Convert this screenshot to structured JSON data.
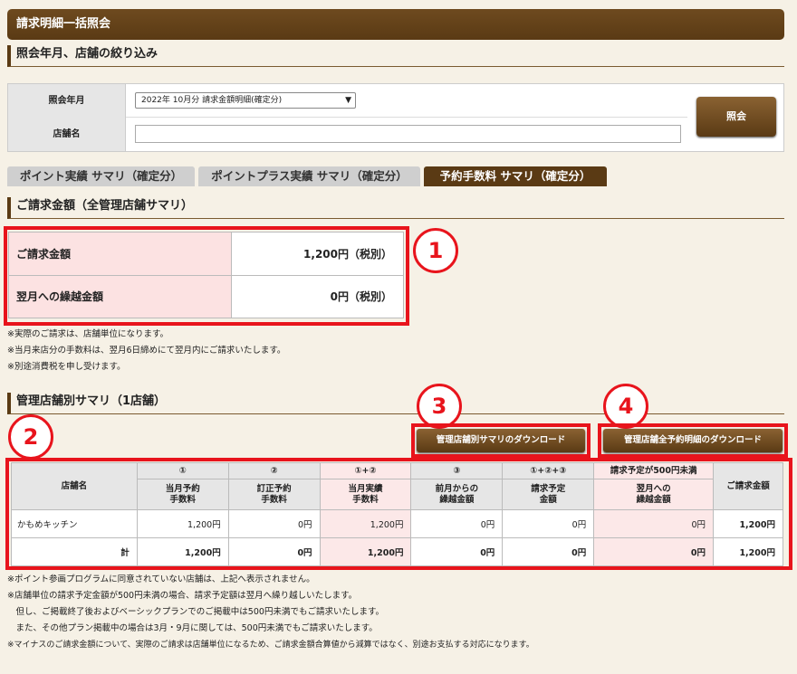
{
  "title": "請求明細一括照会",
  "section_filter": "照会年月、店舗の絞り込み",
  "filter": {
    "month_label": "照会年月",
    "month_value": "2022年 10月分 請求金額明細(確定分)",
    "store_label": "店舗名",
    "store_value": "",
    "query_button": "照会"
  },
  "tabs": [
    "ポイント実績 サマリ（確定分）",
    "ポイントプラス実績 サマリ（確定分）",
    "予約手数料 サマリ（確定分）"
  ],
  "section_billing": "ご請求金額（全管理店舗サマリ）",
  "billing": {
    "rows": [
      {
        "label": "ご請求金額",
        "value": "1,200円（税別）"
      },
      {
        "label": "翌月への繰越金額",
        "value": "0円（税別）"
      }
    ]
  },
  "notes_top": [
    "※実際のご請求は、店舗単位になります。",
    "※当月来店分の手数料は、翌月6日締めにて翌月内にご請求いたします。",
    "※別途消費税を申し受けます。"
  ],
  "section_stores": "管理店舗別サマリ（1店舗）",
  "callouts": [
    "1",
    "2",
    "3",
    "4"
  ],
  "downloads": {
    "store_summary": "管理店舗別サマリのダウンロード",
    "all_details": "管理店舗全予約明細のダウンロード"
  },
  "table": {
    "store_header": "店舗名",
    "total_header": "ご請求金額",
    "pending_group": "請求予定が500円未満",
    "marks": [
      "①",
      "②",
      "①+②",
      "③",
      "①+②+③"
    ],
    "columns": [
      [
        "当月予約",
        "手数料"
      ],
      [
        "訂正予約",
        "手数料"
      ],
      [
        "当月実績",
        "手数料"
      ],
      [
        "前月からの",
        "繰越金額"
      ],
      [
        "請求予定",
        "金額"
      ],
      [
        "翌月への",
        "繰越金額"
      ]
    ],
    "rows": [
      {
        "name": "かもめキッチン",
        "values": [
          "1,200円",
          "0円",
          "1,200円",
          "0円",
          "0円",
          "0円",
          "1,200円"
        ]
      },
      {
        "name": "計",
        "values": [
          "1,200円",
          "0円",
          "1,200円",
          "0円",
          "0円",
          "0円",
          "1,200円"
        ]
      }
    ]
  },
  "notes_bottom": [
    "※ポイント参画プログラムに同意されていない店舗は、上記へ表示されません。",
    "※店舗単位の請求予定金額が500円未満の場合、請求予定額は翌月へ繰り越しいたします。",
    "　但し、ご掲載終了後およびベーシックプランでのご掲載中は500円未満でもご請求いたします。",
    "　また、その他プラン掲載中の場合は3月・9月に関しては、500円未満でもご請求いたします。",
    "※マイナスのご請求金額について、実際のご請求は店舗単位になるため、ご請求金額合算値から減算ではなく、別途お支払する対応になります。"
  ],
  "colors": {
    "brand": "#5a3a14",
    "highlight": "#e8141c",
    "pink": "#fce2e2"
  }
}
